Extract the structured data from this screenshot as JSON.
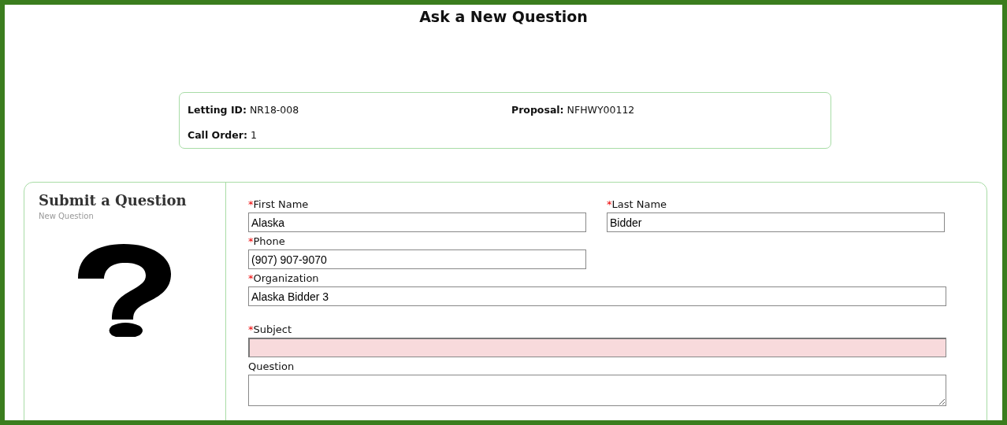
{
  "title": "Ask a New Question",
  "info": [
    {
      "label": "Letting ID:",
      "value": "NR18-008"
    },
    {
      "label": "Proposal:",
      "value": "NFHWY00112"
    },
    {
      "label": "Call Order:",
      "value": "1"
    }
  ],
  "panel": {
    "heading": "Submit a Question",
    "subheading": "New Question"
  },
  "form_rows": [
    [
      {
        "kind": "short-text",
        "required_mark": "*",
        "label": "First Name",
        "value": "Alaska",
        "invalid": false
      },
      {
        "kind": "short-text",
        "required_mark": "*",
        "label": "Last Name",
        "value": "Bidder",
        "invalid": false
      }
    ],
    [
      {
        "kind": "short-text",
        "required_mark": "*",
        "label": "Phone",
        "value": "(907) 907-9070",
        "invalid": false
      }
    ],
    [
      {
        "kind": "long-text",
        "required_mark": "*",
        "label": "Organization",
        "value": "Alaska Bidder 3",
        "invalid": false
      }
    ],
    [
      {
        "kind": "long-text",
        "required_mark": "*",
        "label": "Subject",
        "invalid": true
      }
    ],
    [
      {
        "kind": "textarea",
        "label": "Question",
        "invalid": false
      }
    ]
  ]
}
